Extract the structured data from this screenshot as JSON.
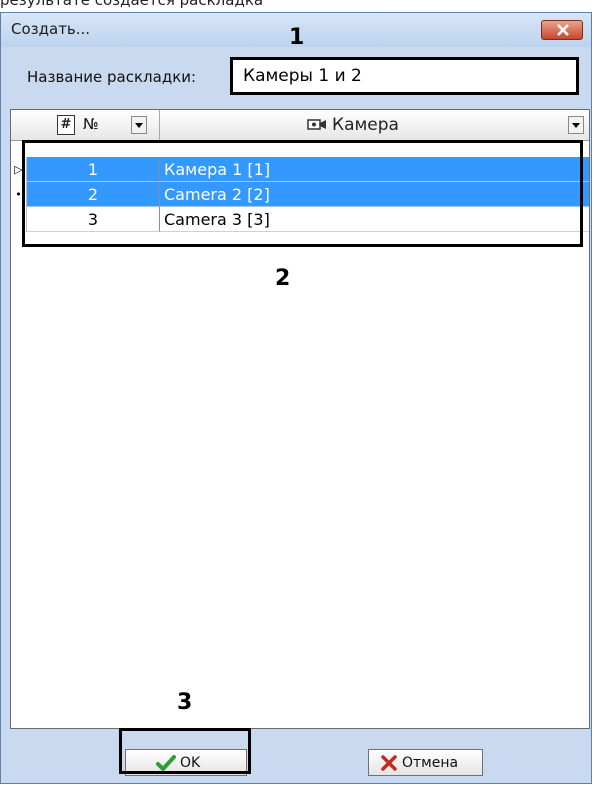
{
  "top_text": "результате создается раскладка",
  "dialog": {
    "title": "Создать...",
    "name_label": "Название раскладки:",
    "name_value": "Камеры 1 и 2"
  },
  "grid": {
    "columns": [
      {
        "label": "№",
        "icon": "hash-icon"
      },
      {
        "label": "Камера",
        "icon": "camera-icon"
      }
    ],
    "rows": [
      {
        "indicator": "▷",
        "num": "1",
        "camera": "Камера 1 [1]",
        "selected": true
      },
      {
        "indicator": "•",
        "num": "2",
        "camera": "Camera 2 [2]",
        "selected": true
      },
      {
        "indicator": "",
        "num": "3",
        "camera": "Camera 3 [3]",
        "selected": false
      }
    ]
  },
  "callouts": {
    "one": "1",
    "two": "2",
    "three": "3"
  },
  "buttons": {
    "ok": "OK",
    "cancel": "Отмена"
  },
  "colors": {
    "selection": "#3399ff",
    "accent_green": "#2e9e2e",
    "cancel_red": "#c42b1c"
  }
}
